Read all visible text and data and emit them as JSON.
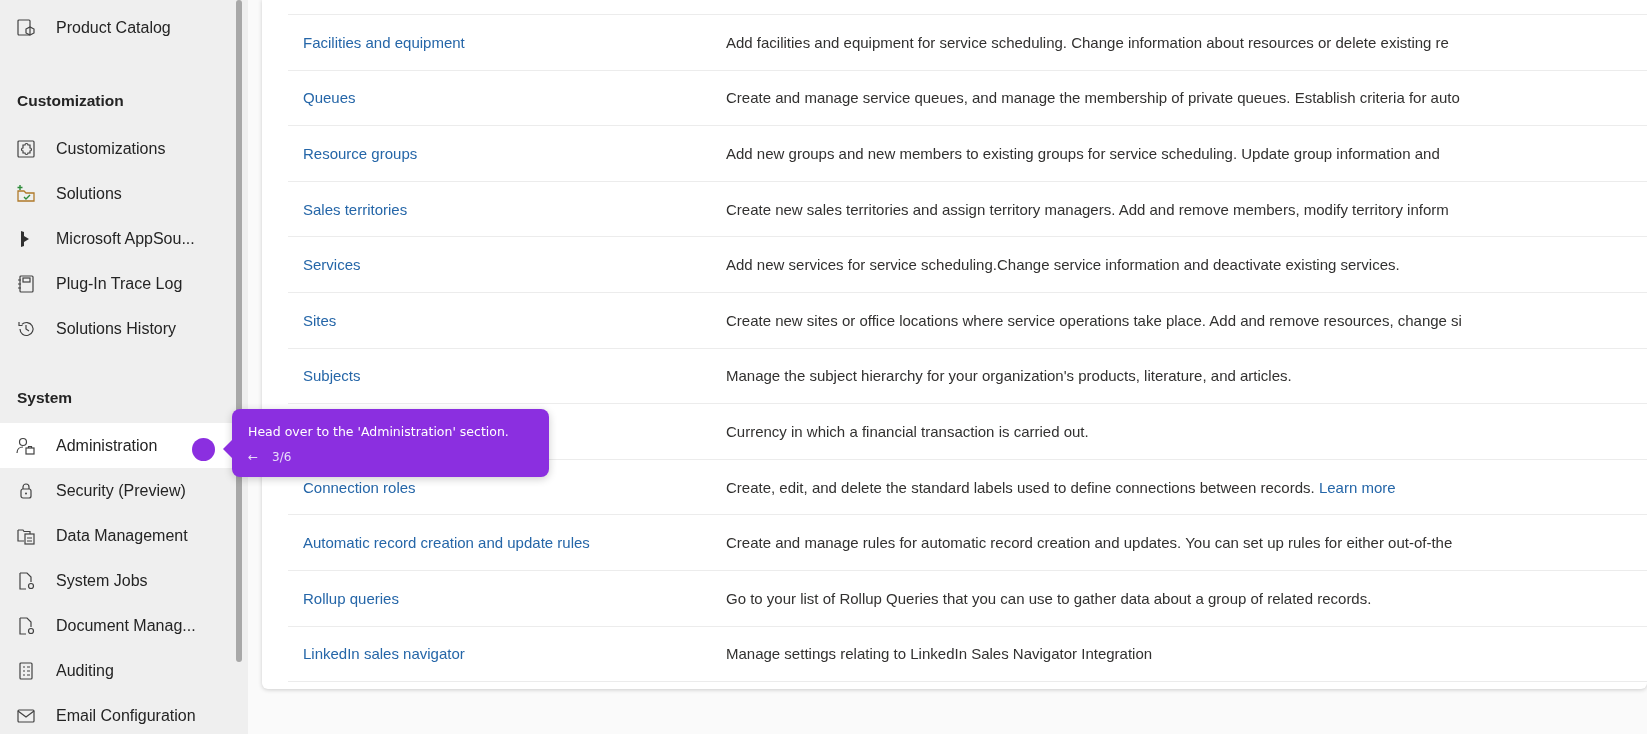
{
  "sidebar": {
    "groups": [
      {
        "items": [
          {
            "label": "Product Catalog",
            "selected": false
          }
        ]
      },
      {
        "heading": "Customization",
        "items": [
          {
            "label": "Customizations",
            "selected": false
          },
          {
            "label": "Solutions",
            "selected": false
          },
          {
            "label": "Microsoft AppSou...",
            "selected": false
          },
          {
            "label": "Plug-In Trace Log",
            "selected": false
          },
          {
            "label": "Solutions History",
            "selected": false
          }
        ]
      },
      {
        "heading": "System",
        "items": [
          {
            "label": "Administration",
            "selected": true
          },
          {
            "label": "Security (Preview)",
            "selected": false
          },
          {
            "label": "Data Management",
            "selected": false
          },
          {
            "label": "System Jobs",
            "selected": false
          },
          {
            "label": "Document Manag...",
            "selected": false
          },
          {
            "label": "Auditing",
            "selected": false
          },
          {
            "label": "Email Configuration",
            "selected": false
          }
        ]
      }
    ]
  },
  "table": {
    "rows": [
      {
        "name": "Facilities and equipment",
        "description": "Add facilities and equipment for service scheduling. Change information about resources or delete existing re"
      },
      {
        "name": "Queues",
        "description": "Create and manage service queues, and manage the membership of private queues. Establish criteria for auto"
      },
      {
        "name": "Resource groups",
        "description": "Add new groups and new members to existing groups for service scheduling. Update group information and"
      },
      {
        "name": "Sales territories",
        "description": "Create new sales territories and assign territory managers. Add and remove members, modify territory inform"
      },
      {
        "name": "Services",
        "description": "Add new services for service scheduling.Change service information and deactivate existing services."
      },
      {
        "name": "Sites",
        "description": "Create new sites or office locations where service operations take place. Add and remove resources, change si"
      },
      {
        "name": "Subjects",
        "description": "Manage the subject hierarchy for your organization's products, literature, and articles."
      },
      {
        "description": "Currency in which a financial transaction is carried out."
      },
      {
        "name": "Connection roles",
        "description": "Create, edit, and delete the standard labels used to define connections between records.",
        "link": "Learn more"
      },
      {
        "name": "Automatic record creation and update rules",
        "description": "Create and manage rules for automatic record creation and updates. You can set up rules for either out-of-the"
      },
      {
        "name": "Rollup queries",
        "description": "Go to your list of Rollup Queries that you can use to gather data about a group of related records."
      },
      {
        "name": "LinkedIn sales navigator",
        "description": "Manage settings relating to LinkedIn Sales Navigator Integration"
      }
    ]
  },
  "tooltip": {
    "text": "Head over to the 'Administration' section.",
    "back": "←",
    "step": "3/6"
  }
}
